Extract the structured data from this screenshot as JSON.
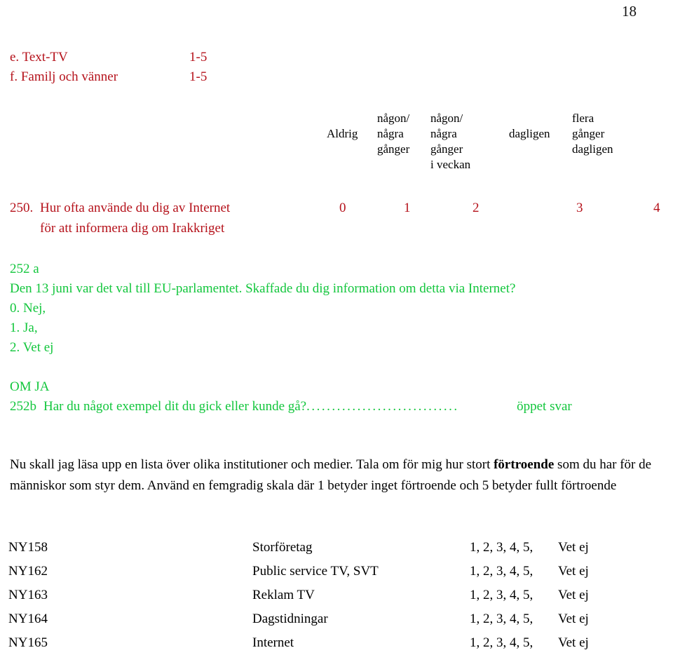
{
  "page": {
    "number": "18",
    "accent_red": "#B5121B",
    "accent_green": "#12C63C",
    "text_black": "#000000"
  },
  "ab_items": [
    {
      "label": "e. Text-TV",
      "scale": "1-5"
    },
    {
      "label": "f. Familj och vänner",
      "scale": "1-5"
    }
  ],
  "scale_header": [
    {
      "label": "Aldrig"
    },
    {
      "label": "någon/\nnågra\ngånger"
    },
    {
      "label": "någon/\nnågra\ngånger\ni veckan"
    },
    {
      "label": "dagligen"
    },
    {
      "label": "flera\ngånger\ndagligen"
    }
  ],
  "question_250": {
    "number": "250.",
    "line1": "Hur ofta använde du dig av Internet",
    "line2": "för att informera dig om Irakkriget",
    "values": [
      "0",
      "1",
      "2",
      "3",
      "4"
    ]
  },
  "question_252a": {
    "id": "252 a",
    "text": "Den 13 juni var det val till EU-parlamentet. Skaffade du dig information om detta via Internet?",
    "options": [
      "0. Nej,",
      "1. Ja,",
      "2. Vet ej"
    ]
  },
  "question_252b": {
    "condition": "OM JA",
    "number": "252b",
    "text": "Har du något exempel dit du gick eller kunde gå?",
    "leader": "..............................",
    "answer_type": "öppet svar"
  },
  "instruction": {
    "part1": "Nu skall jag läsa upp en lista över olika institutioner och medier. Tala om för mig hur stort ",
    "emphasis": "förtroende",
    "part2": " som du har för de människor som styr dem. Använd en femgradig skala där 1 betyder inget förtroende och 5 betyder fullt förtroende"
  },
  "trust_table": {
    "rows": [
      {
        "code": "NY158",
        "item": "Storföretag",
        "scale": "1, 2, 3, 4, 5,",
        "dontknow": "Vet ej"
      },
      {
        "code": "NY162",
        "item": "Public service TV, SVT",
        "scale": "1, 2, 3, 4, 5,",
        "dontknow": "Vet ej"
      },
      {
        "code": "NY163",
        "item": "Reklam TV",
        "scale": "1, 2, 3, 4, 5,",
        "dontknow": "Vet ej"
      },
      {
        "code": "NY164",
        "item": "Dagstidningar",
        "scale": "1, 2, 3, 4, 5,",
        "dontknow": "Vet ej"
      },
      {
        "code": "NY165",
        "item": "Internet",
        "scale": "1, 2, 3, 4, 5,",
        "dontknow": "Vet ej"
      }
    ]
  }
}
